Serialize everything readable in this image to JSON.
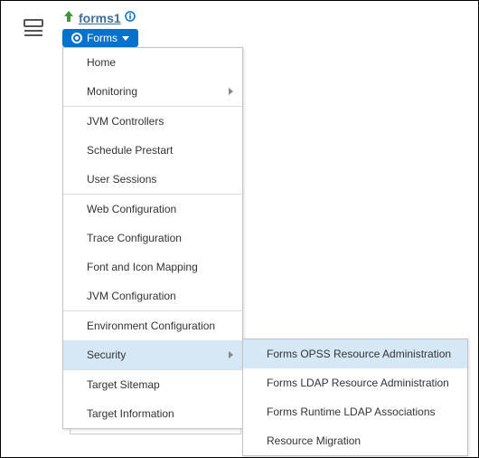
{
  "title": "forms1",
  "formsButton": {
    "label": "Forms"
  },
  "menu": {
    "groups": [
      [
        {
          "label": "Home",
          "submenu": false
        },
        {
          "label": "Monitoring",
          "submenu": true
        }
      ],
      [
        {
          "label": "JVM Controllers",
          "submenu": false
        },
        {
          "label": "Schedule Prestart",
          "submenu": false
        },
        {
          "label": "User Sessions",
          "submenu": false
        }
      ],
      [
        {
          "label": "Web Configuration",
          "submenu": false
        },
        {
          "label": "Trace Configuration",
          "submenu": false
        },
        {
          "label": "Font and Icon Mapping",
          "submenu": false
        },
        {
          "label": "JVM Configuration",
          "submenu": false
        }
      ],
      [
        {
          "label": "Environment Configuration",
          "submenu": false
        },
        {
          "label": "Security",
          "submenu": true,
          "hovered": true
        }
      ],
      [
        {
          "label": "Target Sitemap",
          "submenu": false
        },
        {
          "label": "Target Information",
          "submenu": false
        }
      ]
    ]
  },
  "submenu": {
    "items": [
      {
        "label": "Forms OPSS Resource Administration",
        "hovered": true
      },
      {
        "label": "Forms LDAP Resource Administration",
        "hovered": false
      },
      {
        "label": "Forms Runtime LDAP Associations",
        "hovered": false
      },
      {
        "label": "Resource Migration",
        "hovered": false
      }
    ]
  }
}
